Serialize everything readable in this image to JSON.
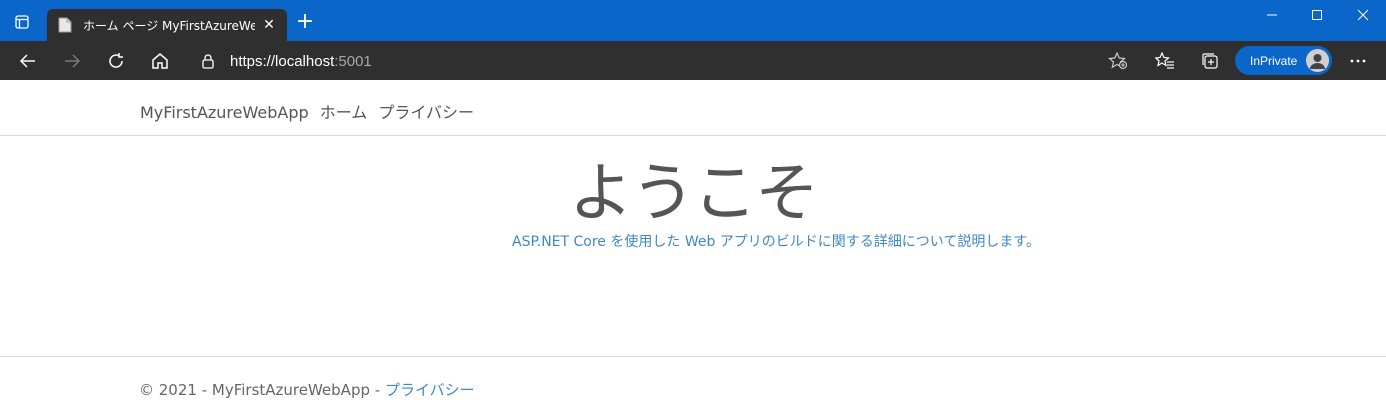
{
  "browser": {
    "tab": {
      "title": "ホーム ページ MyFirstAzureWebApp"
    },
    "address": {
      "scheme": "https://",
      "host": "localhost",
      "port": ":5001"
    },
    "inprivate_label": "InPrivate",
    "colors": {
      "titlebar": "#0a66c8",
      "toolbar": "#2f2f2f",
      "accent": "#0a66c8"
    }
  },
  "navbar": {
    "brand": "MyFirstAzureWebApp",
    "links": [
      "ホーム",
      "プライバシー"
    ]
  },
  "main": {
    "title": "ようこそ",
    "subtitle_link": "ASP.NET Core を使用した Web アプリのビルド",
    "subtitle_rest": "に関する詳細について説明します。"
  },
  "footer": {
    "copyright": "© 2021 - MyFirstAzureWebApp - ",
    "privacy_link": "プライバシー"
  }
}
